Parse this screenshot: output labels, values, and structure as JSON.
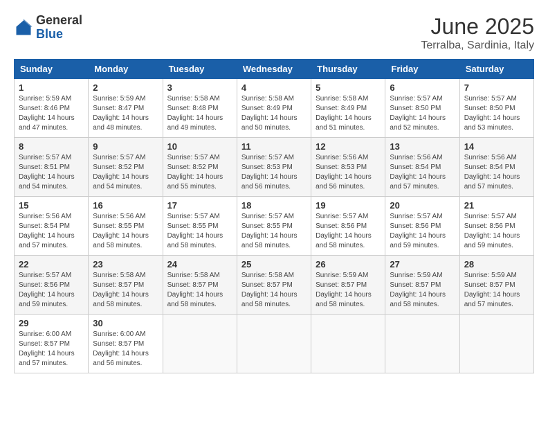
{
  "header": {
    "logo_general": "General",
    "logo_blue": "Blue",
    "title": "June 2025",
    "subtitle": "Terralba, Sardinia, Italy"
  },
  "calendar": {
    "days_of_week": [
      "Sunday",
      "Monday",
      "Tuesday",
      "Wednesday",
      "Thursday",
      "Friday",
      "Saturday"
    ],
    "weeks": [
      [
        {
          "day": "1",
          "sunrise": "5:59 AM",
          "sunset": "8:46 PM",
          "daylight": "14 hours and 47 minutes."
        },
        {
          "day": "2",
          "sunrise": "5:59 AM",
          "sunset": "8:47 PM",
          "daylight": "14 hours and 48 minutes."
        },
        {
          "day": "3",
          "sunrise": "5:58 AM",
          "sunset": "8:48 PM",
          "daylight": "14 hours and 49 minutes."
        },
        {
          "day": "4",
          "sunrise": "5:58 AM",
          "sunset": "8:49 PM",
          "daylight": "14 hours and 50 minutes."
        },
        {
          "day": "5",
          "sunrise": "5:58 AM",
          "sunset": "8:49 PM",
          "daylight": "14 hours and 51 minutes."
        },
        {
          "day": "6",
          "sunrise": "5:57 AM",
          "sunset": "8:50 PM",
          "daylight": "14 hours and 52 minutes."
        },
        {
          "day": "7",
          "sunrise": "5:57 AM",
          "sunset": "8:50 PM",
          "daylight": "14 hours and 53 minutes."
        }
      ],
      [
        {
          "day": "8",
          "sunrise": "5:57 AM",
          "sunset": "8:51 PM",
          "daylight": "14 hours and 54 minutes."
        },
        {
          "day": "9",
          "sunrise": "5:57 AM",
          "sunset": "8:52 PM",
          "daylight": "14 hours and 54 minutes."
        },
        {
          "day": "10",
          "sunrise": "5:57 AM",
          "sunset": "8:52 PM",
          "daylight": "14 hours and 55 minutes."
        },
        {
          "day": "11",
          "sunrise": "5:57 AM",
          "sunset": "8:53 PM",
          "daylight": "14 hours and 56 minutes."
        },
        {
          "day": "12",
          "sunrise": "5:56 AM",
          "sunset": "8:53 PM",
          "daylight": "14 hours and 56 minutes."
        },
        {
          "day": "13",
          "sunrise": "5:56 AM",
          "sunset": "8:54 PM",
          "daylight": "14 hours and 57 minutes."
        },
        {
          "day": "14",
          "sunrise": "5:56 AM",
          "sunset": "8:54 PM",
          "daylight": "14 hours and 57 minutes."
        }
      ],
      [
        {
          "day": "15",
          "sunrise": "5:56 AM",
          "sunset": "8:54 PM",
          "daylight": "14 hours and 57 minutes."
        },
        {
          "day": "16",
          "sunrise": "5:56 AM",
          "sunset": "8:55 PM",
          "daylight": "14 hours and 58 minutes."
        },
        {
          "day": "17",
          "sunrise": "5:57 AM",
          "sunset": "8:55 PM",
          "daylight": "14 hours and 58 minutes."
        },
        {
          "day": "18",
          "sunrise": "5:57 AM",
          "sunset": "8:55 PM",
          "daylight": "14 hours and 58 minutes."
        },
        {
          "day": "19",
          "sunrise": "5:57 AM",
          "sunset": "8:56 PM",
          "daylight": "14 hours and 58 minutes."
        },
        {
          "day": "20",
          "sunrise": "5:57 AM",
          "sunset": "8:56 PM",
          "daylight": "14 hours and 59 minutes."
        },
        {
          "day": "21",
          "sunrise": "5:57 AM",
          "sunset": "8:56 PM",
          "daylight": "14 hours and 59 minutes."
        }
      ],
      [
        {
          "day": "22",
          "sunrise": "5:57 AM",
          "sunset": "8:56 PM",
          "daylight": "14 hours and 59 minutes."
        },
        {
          "day": "23",
          "sunrise": "5:58 AM",
          "sunset": "8:57 PM",
          "daylight": "14 hours and 58 minutes."
        },
        {
          "day": "24",
          "sunrise": "5:58 AM",
          "sunset": "8:57 PM",
          "daylight": "14 hours and 58 minutes."
        },
        {
          "day": "25",
          "sunrise": "5:58 AM",
          "sunset": "8:57 PM",
          "daylight": "14 hours and 58 minutes."
        },
        {
          "day": "26",
          "sunrise": "5:59 AM",
          "sunset": "8:57 PM",
          "daylight": "14 hours and 58 minutes."
        },
        {
          "day": "27",
          "sunrise": "5:59 AM",
          "sunset": "8:57 PM",
          "daylight": "14 hours and 58 minutes."
        },
        {
          "day": "28",
          "sunrise": "5:59 AM",
          "sunset": "8:57 PM",
          "daylight": "14 hours and 57 minutes."
        }
      ],
      [
        {
          "day": "29",
          "sunrise": "6:00 AM",
          "sunset": "8:57 PM",
          "daylight": "14 hours and 57 minutes."
        },
        {
          "day": "30",
          "sunrise": "6:00 AM",
          "sunset": "8:57 PM",
          "daylight": "14 hours and 56 minutes."
        },
        null,
        null,
        null,
        null,
        null
      ]
    ]
  }
}
